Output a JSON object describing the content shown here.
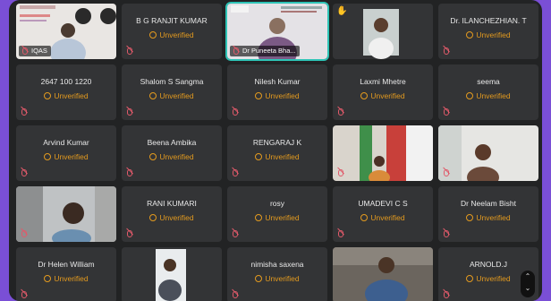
{
  "status_unverified": "Unverified",
  "row1": {
    "t1_label": "IQAS",
    "t2_name": "B G RANJIT KUMAR",
    "t3_label": "Dr Puneeta Bha...",
    "t5_name": "Dr. ILANCHEZHIAN. T"
  },
  "row2": [
    "2647 100 1220",
    "Shalom S Sangma",
    "Nilesh Kumar",
    "Laxmi Mhetre",
    "seema"
  ],
  "row3": [
    "Arvind Kumar",
    "Beena Ambika",
    "RENGARAJ K"
  ],
  "row4": {
    "t2": "RANI KUMARI",
    "t3": "rosy",
    "t4": "UMADEVI C S",
    "t5": "Dr Neelam Bisht"
  },
  "row5": {
    "t1": "Dr Helen William",
    "t3": "nimisha saxena",
    "t5": "ARNOLD.J"
  },
  "colors": {
    "accent": "#2ec4b6",
    "unverified": "#e39a1f",
    "muted_mic": "#e05a6a",
    "background": "#7a4fd6"
  },
  "icons": [
    "mic-off-icon",
    "raised-hand-icon",
    "unverified-icon",
    "chevron-up-icon",
    "chevron-down-icon"
  ]
}
